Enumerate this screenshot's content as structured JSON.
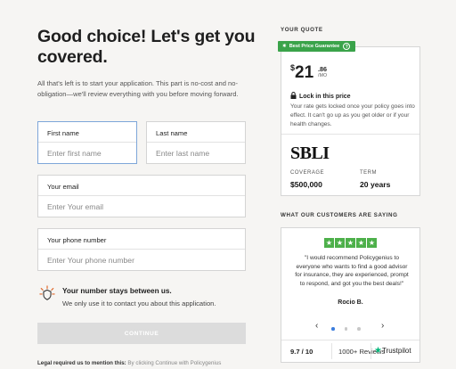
{
  "heading": "Good choice! Let's get you covered.",
  "intro": "All that's left is to start your application. This part is no-cost and no-obligation—we'll review everything with you before moving forward.",
  "form": {
    "first_name": {
      "label": "First name",
      "placeholder": "Enter first name"
    },
    "last_name": {
      "label": "Last name",
      "placeholder": "Enter last name"
    },
    "email": {
      "label": "Your email",
      "placeholder": "Enter Your email"
    },
    "phone": {
      "label": "Your phone number",
      "placeholder": "Enter Your phone number"
    }
  },
  "privacy": {
    "title": "Your number stays between us.",
    "text": "We only use it to contact you about this application."
  },
  "continue_label": "CONTINUE",
  "legal": {
    "bold": "Legal required us to mention this:",
    "rest": " By clicking Continue with Policygenius"
  },
  "quote": {
    "section_title": "YOUR QUOTE",
    "badge": "Best Price Guarantee",
    "badge_help": "?",
    "currency": "$",
    "dollars": "21",
    "cents": ".86",
    "period": "/MO",
    "lock_title": "Lock in this price",
    "lock_text": "Your rate gets locked once your policy goes into effect. It can't go up as you get older or if your health changes.",
    "carrier": "SBLI",
    "coverage_label": "COVERAGE",
    "coverage_value": "$500,000",
    "term_label": "TERM",
    "term_value": "20 years"
  },
  "reviews": {
    "section_title": "WHAT OUR CUSTOMERS ARE SAYING",
    "stars": 5,
    "text": "\"I would recommend Policygenius to everyone who wants to find a good advisor for insurance, they are experienced, prompt to respond, and got you the best deals!\"",
    "author": "Rocio B.",
    "prev": "‹",
    "next": "›",
    "rating": "9.7 / 10",
    "count": "1000+ Reviews",
    "trustpilot": "Trustpilot"
  },
  "colors": {
    "accent_green": "#3aa34a",
    "trustpilot_green": "#00b67a",
    "focus_blue": "#7ea6d9"
  }
}
